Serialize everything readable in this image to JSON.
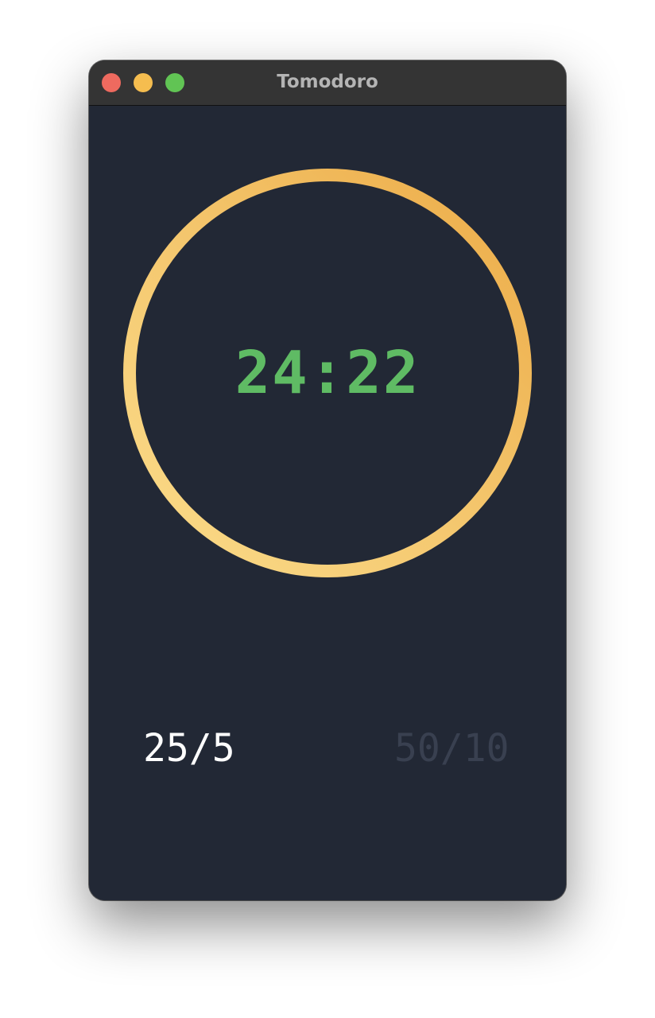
{
  "window": {
    "title": "Tomodoro",
    "traffic_lights": {
      "close_color": "#ee6a5f",
      "minimize_color": "#f5bd4f",
      "zoom_color": "#61c454"
    },
    "background_color": "#222835"
  },
  "timer": {
    "time": "24:22",
    "time_color": "#5fbb64",
    "ring_gradient": [
      "#fbdc8a",
      "#f4c66d",
      "#ecab47"
    ]
  },
  "presets": [
    {
      "label": "25/5",
      "selected": true,
      "color": "#ffffff"
    },
    {
      "label": "50/10",
      "selected": false,
      "color": "#394050"
    }
  ]
}
